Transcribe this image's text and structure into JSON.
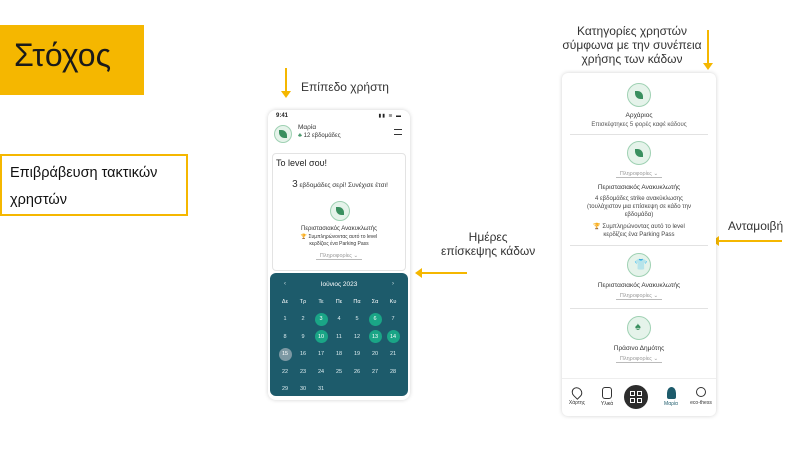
{
  "slide": {
    "title": "Στόχος",
    "reward_box": [
      "Επιβράβευση τακτικών",
      "χρηστών"
    ]
  },
  "annotations": {
    "user_level": "Επίπεδο χρήστη",
    "visit_days": [
      "Ημέρες",
      "επίσκεψης κάδων"
    ],
    "categories": [
      "Κατηγορίες χρηστών",
      "σύμφωνα με την συνέπεια",
      "χρήσης των κάδων"
    ],
    "reward": "Ανταμοιβή"
  },
  "phone_left": {
    "time": "9:41",
    "status_icons": "▮▮ ≋ ▬",
    "user_name": "Μαρία",
    "weeks_badge": "12 εβδομάδες",
    "level_title": "Το level σου!",
    "weeks_number": "3",
    "weeks_text": "εβδομάδες σερί! Συνέχισε έτσι!",
    "category": "Περιστασιακός Ανακυκλωτής",
    "reward_lines": [
      "Συμπληρώνοντας αυτό το level",
      "κερδίζεις ένα Parking Pass"
    ],
    "info_label": "Πληροφορίες ⌄",
    "calendar": {
      "month": "Ιούνιος 2023",
      "prev": "‹",
      "next": "›",
      "weekdays": [
        "Δε",
        "Τρ",
        "Τε",
        "Πε",
        "Πα",
        "Σα",
        "Κυ"
      ],
      "rows": [
        [
          "",
          "",
          "",
          "1",
          "2",
          "3",
          "4"
        ],
        [
          "5",
          "6",
          "7",
          "8",
          "9",
          "10",
          "11"
        ],
        [
          "12",
          "13",
          "14",
          "15",
          "16",
          "17",
          "18"
        ],
        [
          "19",
          "20",
          "21",
          "22",
          "23",
          "24",
          "25"
        ],
        [
          "26",
          "27",
          "28",
          "29",
          "30",
          "",
          ""
        ],
        [
          "",
          "",
          "",
          "",
          "",
          "",
          ""
        ]
      ],
      "display_rows": [
        [
          "1",
          "2",
          "3",
          "4",
          "5",
          "6",
          "7"
        ],
        [
          "8",
          "9",
          "10",
          "11",
          "12",
          "13",
          "14"
        ],
        [
          "15",
          "16",
          "17",
          "18",
          "19",
          "20",
          "21"
        ],
        [
          "22",
          "23",
          "24",
          "25",
          "26",
          "27",
          "28"
        ],
        [
          "29",
          "30",
          "31",
          "",
          "",
          "",
          ""
        ]
      ],
      "visit_days": [
        "3",
        "6",
        "10",
        "13",
        "14"
      ],
      "today": "15"
    }
  },
  "phone_right": {
    "categories": [
      {
        "name": "Αρχάριος",
        "desc": "Επισκέφτηκες 5 φορές καφέ κάδους"
      },
      {
        "name": "Περιστασιακός Ανακυκλωτής",
        "desc": [
          "4 εβδομάδες strike ανακύκλωσης",
          "(τουλάχιστον μια επίσκεψη σε κάδο την",
          "εβδομάδα)"
        ],
        "reward": [
          "Συμπληρώνοντας αυτό το level",
          "κερδίζεις ένα Parking Pass"
        ]
      },
      {
        "name": "Περιστασιακός Ανακυκλωτής"
      },
      {
        "name": "Πράσινο Δημότης"
      }
    ],
    "info_label": "Πληροφορίες ⌄",
    "tabs": [
      "Χάρτης",
      "Υλικά",
      "",
      "Μαρία",
      "eco-thess"
    ]
  },
  "colors": {
    "accent": "#f5b700",
    "calendar_bg": "#1d5b6b",
    "visit_day": "#1aa586",
    "brand_green": "#3a8f5f"
  }
}
